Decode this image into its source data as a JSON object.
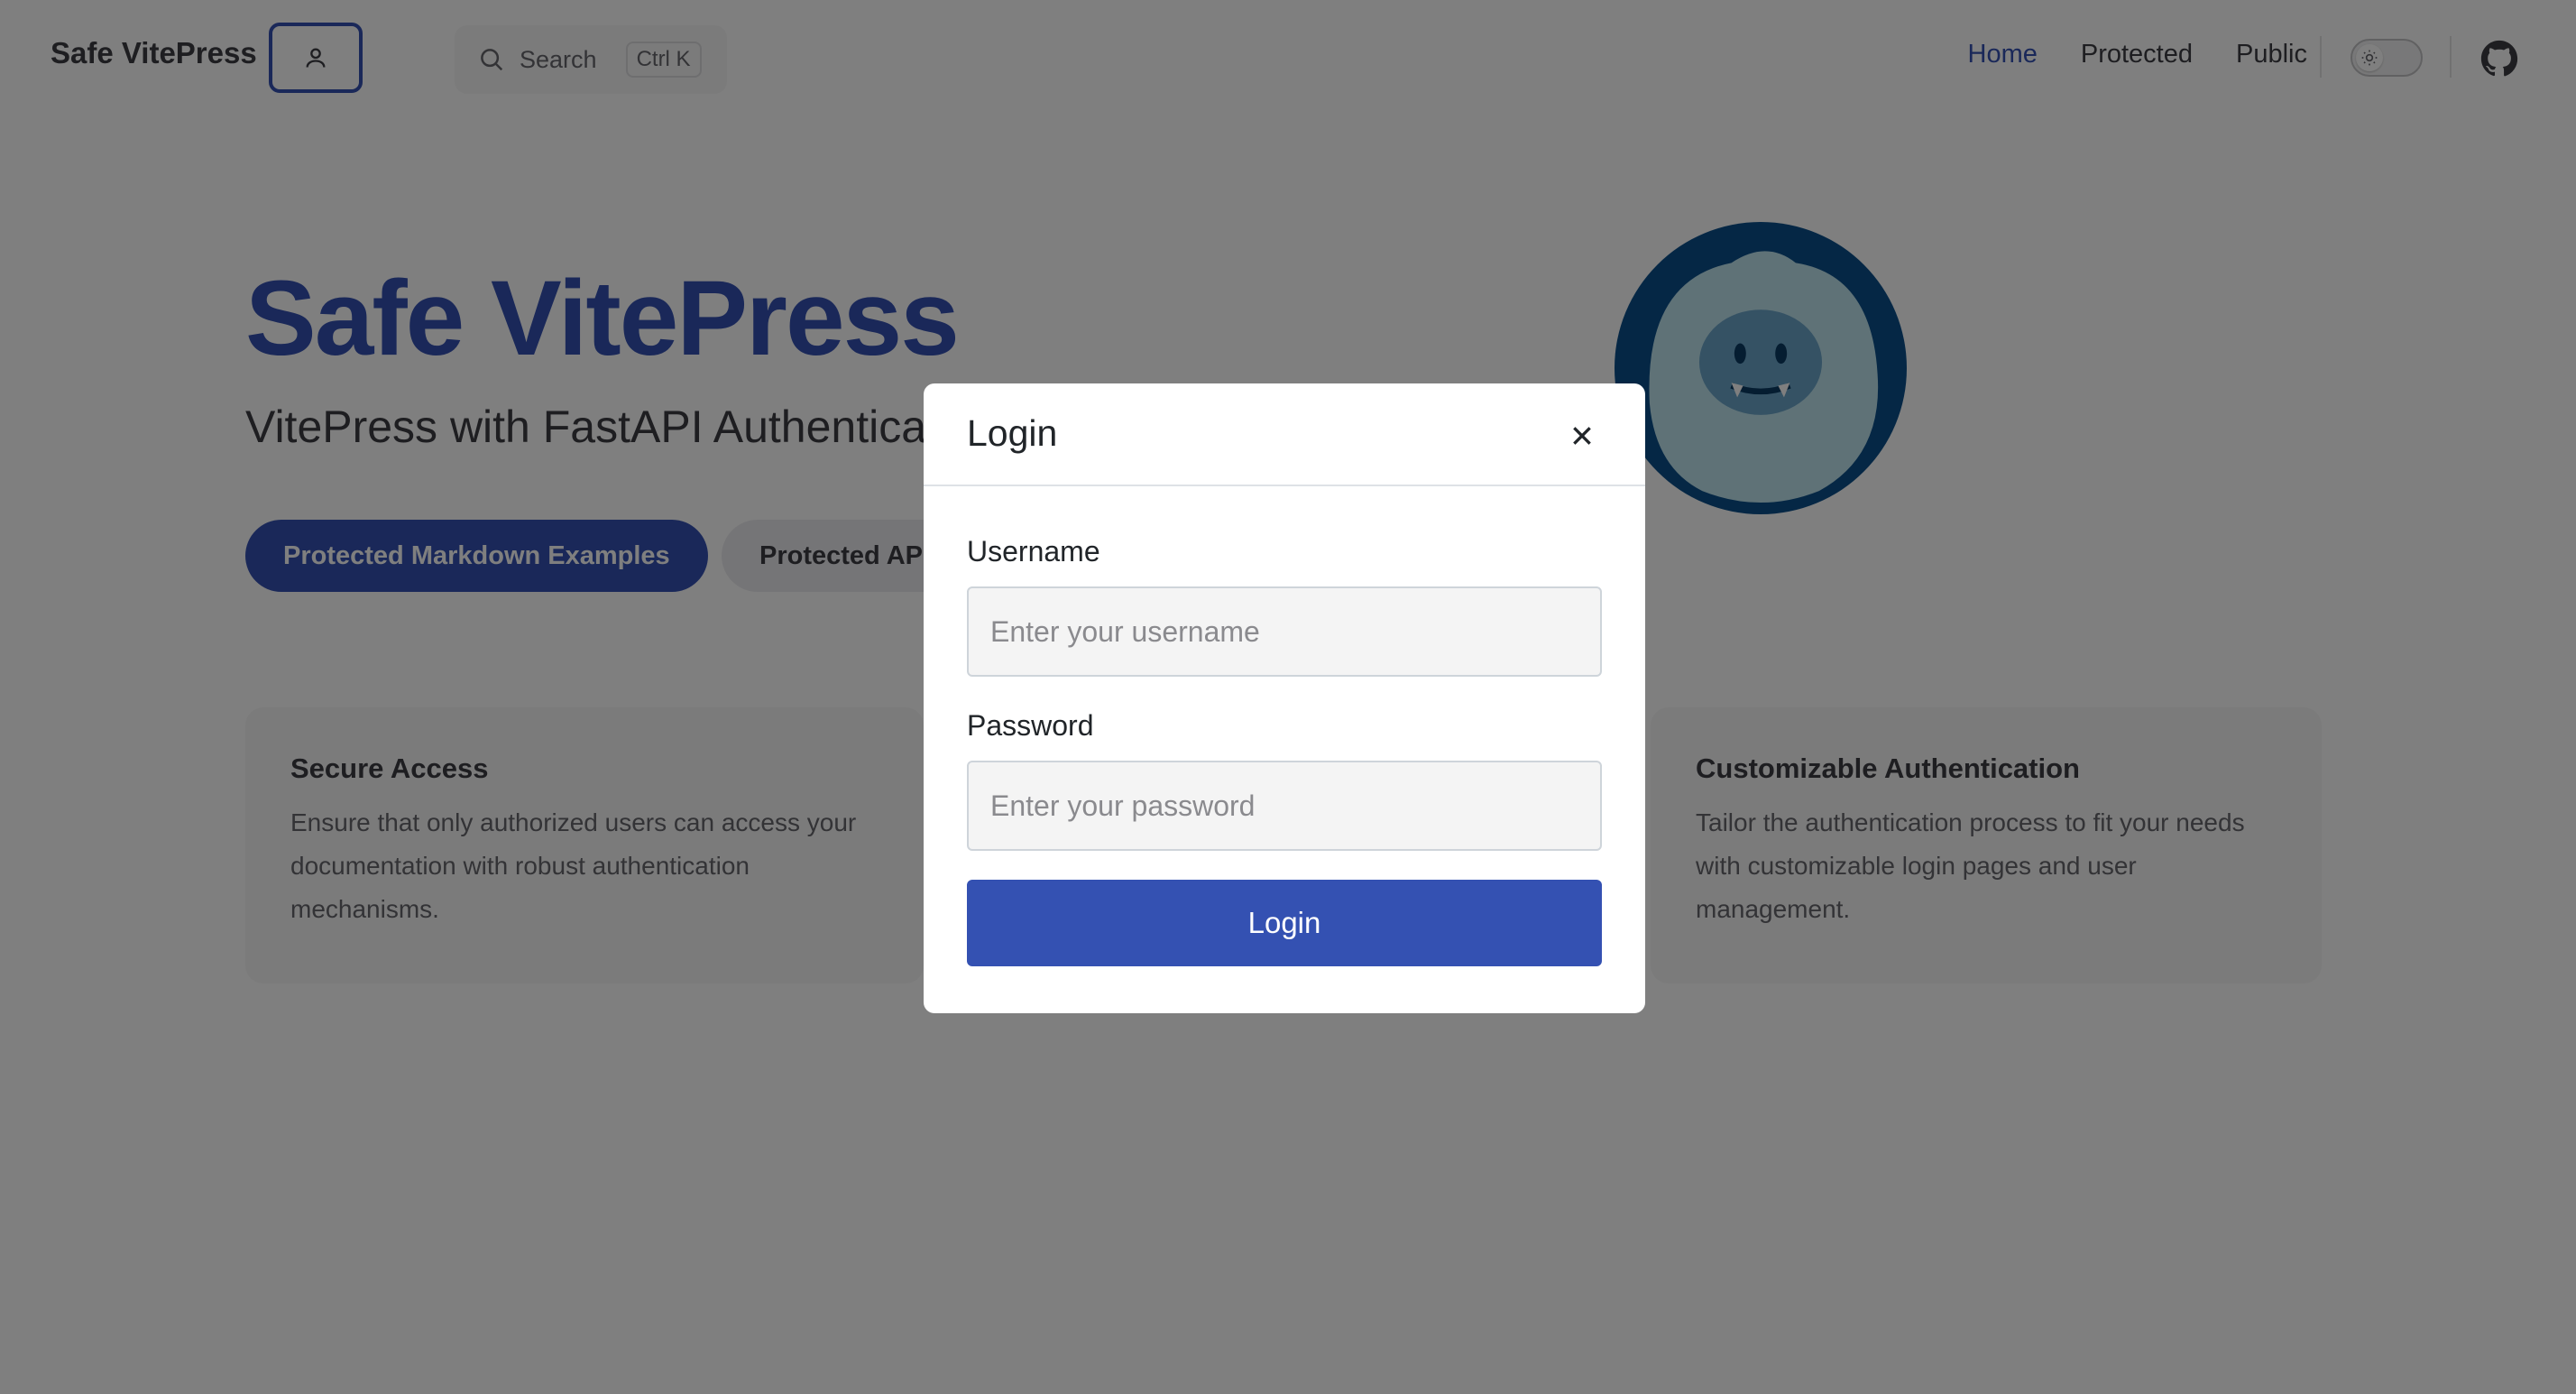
{
  "nav": {
    "brand": "Safe VitePress",
    "search_label": "Search",
    "search_kbd": "Ctrl K",
    "links": [
      {
        "label": "Home",
        "active": true
      },
      {
        "label": "Protected",
        "active": false
      },
      {
        "label": "Public",
        "active": false
      }
    ],
    "icons": {
      "user": "user-icon",
      "search": "search-icon",
      "theme": "sun-icon",
      "github": "github-icon"
    }
  },
  "hero": {
    "title": "Safe VitePress",
    "subtitle": "VitePress with FastAPI Authentication",
    "primary_action": "Protected Markdown Examples",
    "secondary_action": "Protected API Examples"
  },
  "features": [
    {
      "title": "Secure Access",
      "text": "Ensure that only authorized users can access your documentation with robust authentication mechanisms."
    },
    {
      "title": "Customizable Authentication",
      "text": "Tailor the authentication process to fit your needs with customizable login pages and user management."
    }
  ],
  "modal": {
    "title": "Login",
    "username_label": "Username",
    "username_placeholder": "Enter your username",
    "password_label": "Password",
    "password_placeholder": "Enter your password",
    "submit_label": "Login"
  },
  "colors": {
    "brand": "#3451b2",
    "overlay": "rgba(0,0,0,0.5)",
    "mascot_ring": "#0b4f8a",
    "mascot_fur": "#bfe4ef"
  }
}
